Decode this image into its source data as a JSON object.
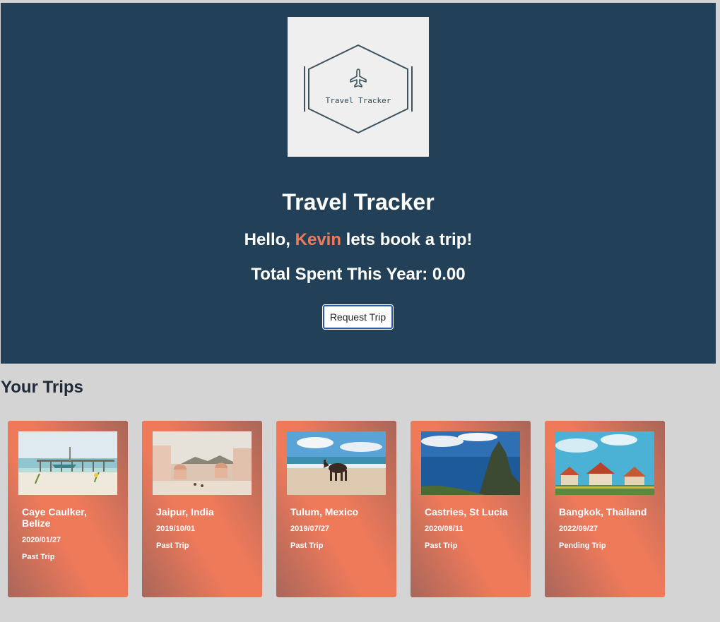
{
  "header": {
    "logo_text": "Travel Tracker",
    "title": "Travel Tracker",
    "greeting_prefix": "Hello, ",
    "user_name": "Kevin",
    "greeting_suffix": " lets book a trip!",
    "total_spent": "Total Spent This Year: 0.00",
    "request_button": "Request Trip"
  },
  "trips_heading": "Your Trips",
  "trips": [
    {
      "destination": "Caye Caulker, Belize",
      "date": "2020/01/27",
      "status": "Past Trip"
    },
    {
      "destination": "Jaipur, India",
      "date": "2019/10/01",
      "status": "Past Trip"
    },
    {
      "destination": "Tulum, Mexico",
      "date": "2019/07/27",
      "status": "Past Trip"
    },
    {
      "destination": "Castries, St Lucia",
      "date": "2020/08/11",
      "status": "Past Trip"
    },
    {
      "destination": "Bangkok, Thailand",
      "date": "2022/09/27",
      "status": "Pending Trip"
    }
  ],
  "colors": {
    "header_bg": "#224158",
    "accent": "#ef7a5a",
    "page_bg": "#d4d4d4"
  }
}
